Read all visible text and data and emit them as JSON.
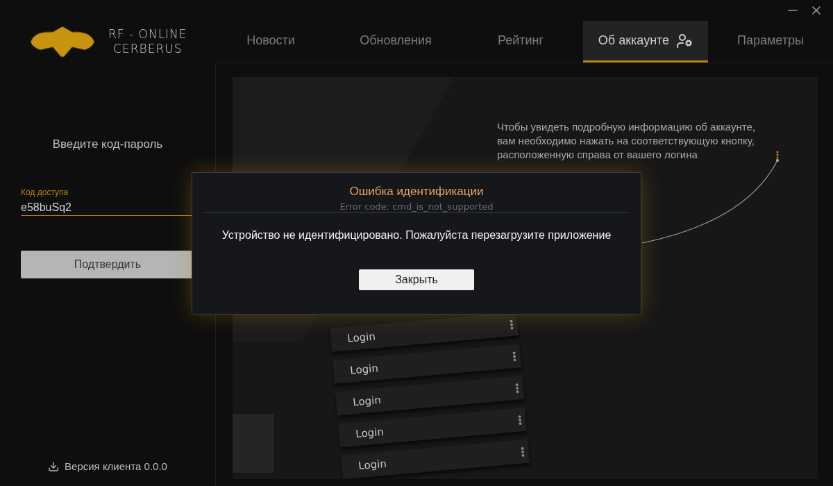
{
  "brand": {
    "line_1": "RF - ONLINE",
    "line_2": "CERBERUS"
  },
  "tabs": [
    {
      "label": "Новости",
      "selected": false
    },
    {
      "label": "Обновления",
      "selected": false
    },
    {
      "label": "Рейтинг",
      "selected": false
    },
    {
      "label": "Об аккаунте",
      "selected": true,
      "kind": "account"
    },
    {
      "label": "Параметры",
      "selected": false
    }
  ],
  "login_panel": {
    "heading": "Введите код-пароль",
    "field": {
      "label": "Код доступа",
      "value": "e58buSq2"
    },
    "submit": "Подтвердить",
    "version": "Версия клиента 0.0.0"
  },
  "preview": {
    "hint": "Чтобы увидеть подробную информацию об аккаунте, вам необходимо нажать на соответствующую кнопку, расположенную справа от вашего логина",
    "rows": [
      {
        "login": "Login"
      },
      {
        "login": "Login"
      },
      {
        "login": "Login"
      },
      {
        "login": "Login"
      },
      {
        "login": "Login"
      }
    ]
  },
  "dialog": {
    "title": "Ошибка идентификации",
    "error_code": "Error code: cmd_is_not_supported",
    "message": "Устройство не идентифицировано. Пожалуйста перезагрузите приложение",
    "close": "Закрыть"
  }
}
